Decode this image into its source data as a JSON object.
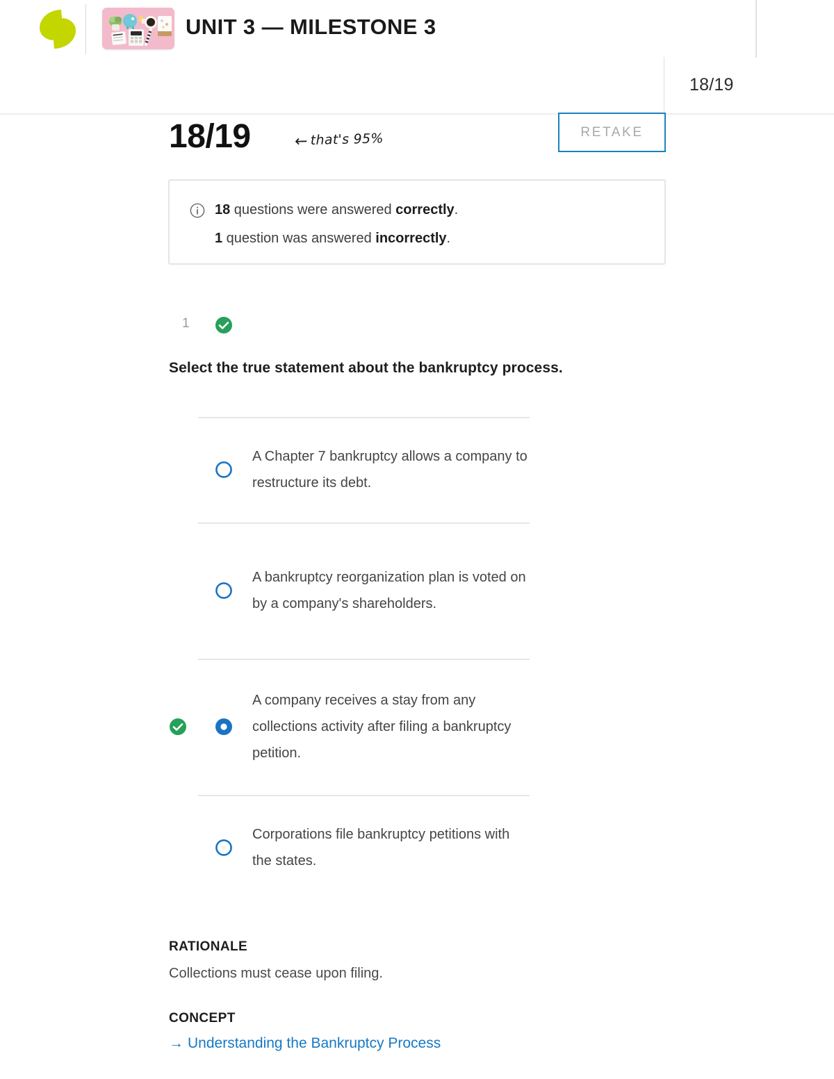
{
  "header": {
    "logo_icon": "sophia-logo-icon",
    "thumbnail_icon": "course-thumbnail-image",
    "title": "UNIT 3 — MILESTONE 3"
  },
  "score_badge": {
    "value": "18/19"
  },
  "score_row": {
    "score": "18/19",
    "annotation_arrow": "←",
    "annotation_text": "that's 95%",
    "retake_label": "RETAKE"
  },
  "info_box": {
    "icon": "info-circle-icon",
    "line1": {
      "count": "18",
      "middle": " questions were answered ",
      "emphasis": "correctly",
      "end": "."
    },
    "line2": {
      "count": "1",
      "middle": " question was answered ",
      "emphasis": "incorrectly",
      "end": "."
    }
  },
  "question": {
    "number": "1",
    "status_icon": "green-check-circle-icon",
    "status": "correct",
    "text": "Select the true statement about the bankruptcy process.",
    "options": [
      {
        "label": "A Chapter 7 bankruptcy allows a company to restructure its debt.",
        "selected": false,
        "is_correct": false
      },
      {
        "label": "A bankruptcy reorganization plan is voted on by a company's shareholders.",
        "selected": false,
        "is_correct": false
      },
      {
        "label": "A company receives a stay from any collections activity after filing a bankruptcy petition.",
        "selected": true,
        "is_correct": true
      },
      {
        "label": "Corporations file bankruptcy petitions with the states.",
        "selected": false,
        "is_correct": false
      }
    ]
  },
  "rationale": {
    "heading": "RATIONALE",
    "text": "Collections must cease upon filing."
  },
  "concept": {
    "heading": "CONCEPT",
    "link_arrow": "→",
    "link_text": "Understanding the Bankruptcy Process"
  },
  "colors": {
    "brand_green": "#c3d600",
    "accent_blue": "#1779c4",
    "radio_blue": "#1b73c4",
    "correct_green": "#27a05a",
    "thumbnail_pink": "#f2b9c9",
    "muted_gray": "#a9a9a9"
  }
}
